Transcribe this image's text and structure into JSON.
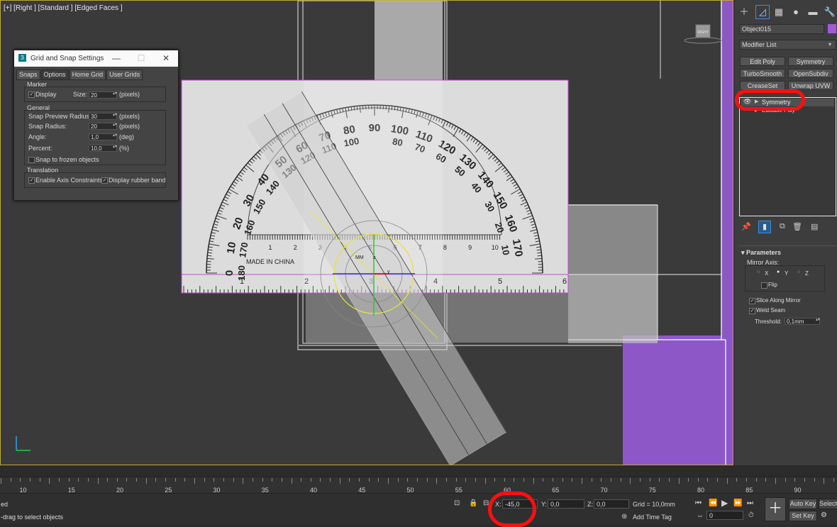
{
  "viewport": {
    "label": "[+] [Right ] [Standard ] [Edged Faces ]",
    "viewcube_label": "RIGHT",
    "gizmo_labels": {
      "x": "x",
      "y": "y",
      "z": "z",
      "mm": "MM"
    }
  },
  "protractor": {
    "outer_numbers": [
      "0",
      "10",
      "20",
      "30",
      "40",
      "50",
      "60",
      "70",
      "80",
      "90",
      "100",
      "110",
      "120",
      "130",
      "140",
      "150",
      "160",
      "170"
    ],
    "inner_numbers": [
      "180",
      "170",
      "160",
      "150",
      "140",
      "130",
      "120",
      "110",
      "100",
      "80",
      "70",
      "60",
      "50",
      "40",
      "30",
      "20",
      "10"
    ],
    "ruler_numbers": [
      "1",
      "2",
      "3",
      "4",
      "5",
      "6",
      "7",
      "8",
      "9",
      "10"
    ],
    "inch_numbers": [
      "1",
      "2",
      "3",
      "4",
      "5",
      "6"
    ],
    "made_in": "MADE IN CHINA"
  },
  "dialog": {
    "title": "Grid and Snap Settings",
    "icon": "3",
    "tabs": [
      "Snaps",
      "Options",
      "Home Grid",
      "User Grids"
    ],
    "marker": {
      "title": "Marker",
      "display_label": "Display",
      "display_checked": true,
      "size_label": "Size:",
      "size_value": "20",
      "size_unit": "(pixels)"
    },
    "general": {
      "title": "General",
      "preview_radius_label": "Snap Preview Radius:",
      "preview_radius_value": "30",
      "snap_radius_label": "Snap Radius:",
      "snap_radius_value": "20",
      "angle_label": "Angle:",
      "angle_value": "1,0",
      "percent_label": "Percent:",
      "percent_value": "10,0",
      "pixels_unit": "(pixels)",
      "deg_unit": "(deg)",
      "pct_unit": "(%)",
      "frozen_label": "Snap to frozen objects",
      "frozen_checked": false
    },
    "translation": {
      "title": "Translation",
      "axis_label": "Enable Axis Constraints",
      "axis_checked": true,
      "rubber_label": "Display rubber band",
      "rubber_checked": true
    }
  },
  "command_panel": {
    "object_name": "Object015",
    "object_color": "#a259d6",
    "modifier_list": "Modifier List",
    "buttons": [
      "Edit Poly",
      "Symmetry",
      "TurboSmooth",
      "OpenSubdiv",
      "CreaseSet",
      "Unwrap UVW"
    ],
    "stack_items": [
      "Symmetry",
      "Editable Poly"
    ],
    "parameters": {
      "title": "Parameters",
      "mirror_axis_label": "Mirror Axis:",
      "axes": [
        "X",
        "Y",
        "Z"
      ],
      "selected_axis": "Y",
      "flip_label": "Flip",
      "slice_label": "Slice Along Mirror",
      "weld_label": "Weld Seam",
      "threshold_label": "Threshold:",
      "threshold_value": "0,1mm"
    }
  },
  "timeline": {
    "labels": [
      "10",
      "15",
      "20",
      "25",
      "30",
      "35",
      "40",
      "45",
      "50",
      "55",
      "60",
      "65",
      "70",
      "75",
      "80",
      "85",
      "90"
    ]
  },
  "status": {
    "left_top": "ed",
    "left_bottom": "-drag to select objects",
    "x_label": "X:",
    "x_value": "-45,0",
    "y_label": "Y:",
    "y_value": "0,0",
    "z_label": "Z:",
    "z_value": "0,0",
    "grid": "Grid = 10,0mm",
    "add_time_tag": "Add Time Tag",
    "frame_value": "0",
    "auto_key": "Auto Key",
    "set_key": "Set Key",
    "selected": "Selecte"
  },
  "colors": {
    "viewport_border": "#c8a43a",
    "purple_object": "#8e57c8",
    "annotation_red": "#ff1010",
    "gizmo_yellow": "#e8e23a"
  }
}
